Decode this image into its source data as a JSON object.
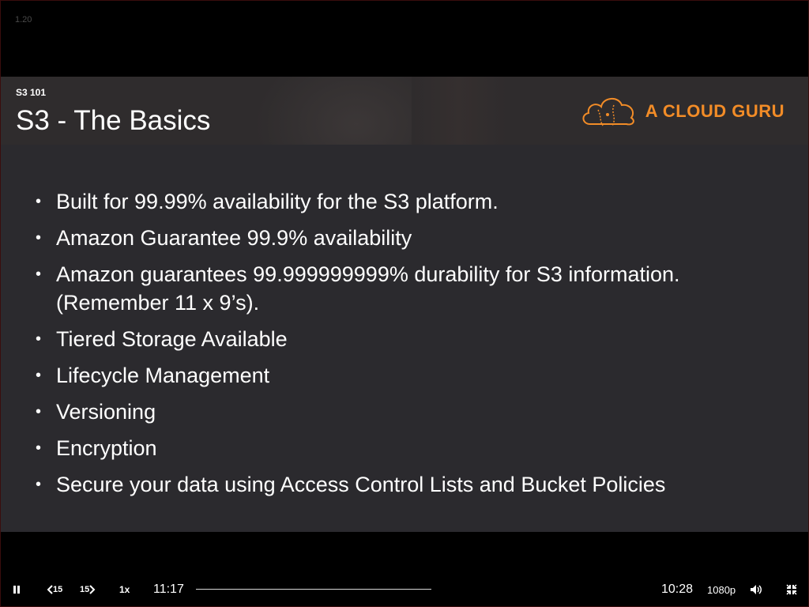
{
  "player": {
    "version": "1.20"
  },
  "slide": {
    "section": "S3 101",
    "title": "S3 - The Basics",
    "logo_text": "A CLOUD GURU",
    "bullets": [
      "Built for 99.99% availability for the S3 platform.",
      "Amazon Guarantee 99.9% availability",
      "Amazon guarantees 99.999999999% durability for S3 information. (Remember 11 x 9’s).",
      "Tiered Storage Available",
      "Lifecycle Management",
      "Versioning",
      "Encryption",
      "Secure your data using Access Control Lists and Bucket Policies"
    ]
  },
  "controls": {
    "back_label": "15",
    "forward_label": "15",
    "speed": "1x",
    "current_time": "11:17",
    "remaining_time": "10:28",
    "quality": "1080p",
    "progress_fraction": 0.0,
    "icons": {
      "play_pause": "pause-icon",
      "back": "rewind-15-icon",
      "forward": "forward-15-icon",
      "volume": "volume-icon",
      "fullscreen": "exit-fullscreen-icon"
    }
  },
  "colors": {
    "brand_accent": "#f28c27",
    "slide_background": "#2b2a2e"
  }
}
